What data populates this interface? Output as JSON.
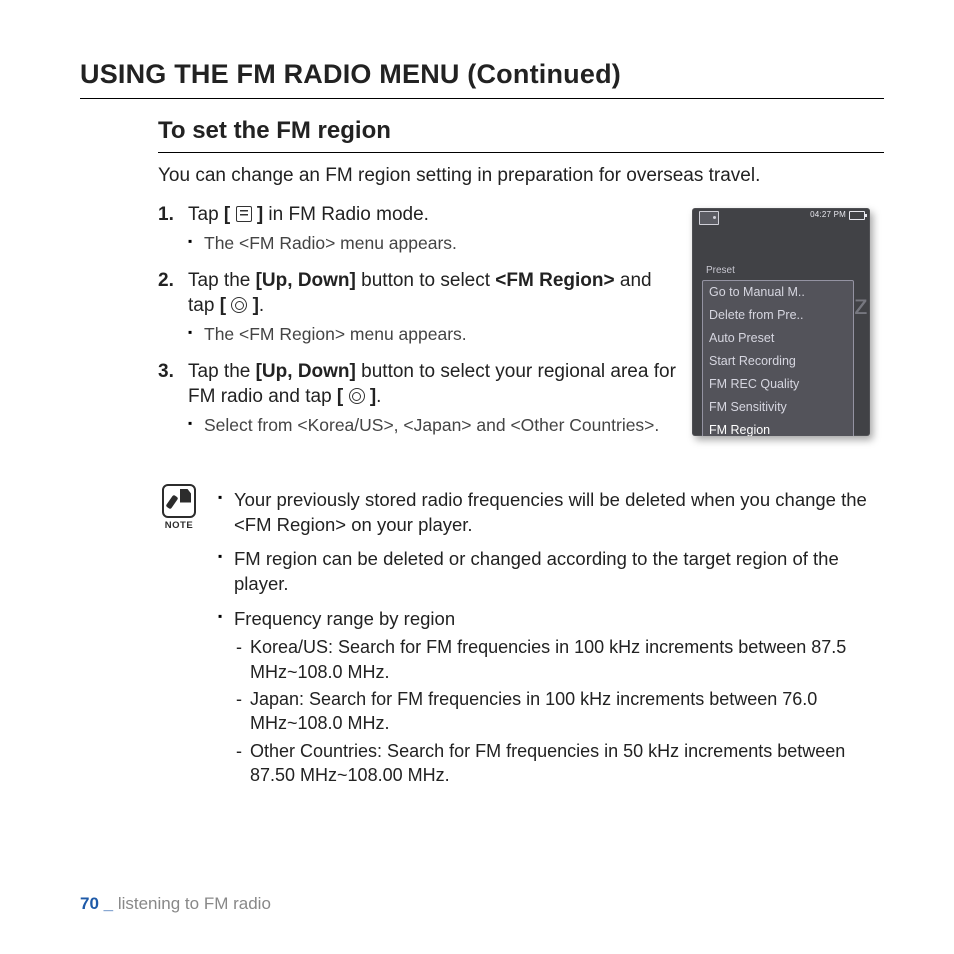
{
  "heading_main": "USING THE FM RADIO MENU (Continued)",
  "heading_sub": "To set the FM region",
  "intro": "You can change an FM region setting in preparation for overseas travel.",
  "steps": [
    {
      "num": "1.",
      "body_pre": "Tap ",
      "body_post": " in FM Radio mode.",
      "br1": "[",
      "br2": "]",
      "sub": "The <FM Radio> menu appears."
    },
    {
      "num": "2.",
      "line1": "Tap the ",
      "bold1": "[Up, Down]",
      "mid1": " button to select ",
      "bold2": "<FM Region>",
      "mid2": " and tap ",
      "br1": "[",
      "br2": "]",
      "end": ".",
      "sub": "The <FM Region> menu appears."
    },
    {
      "num": "3.",
      "line1": "Tap the ",
      "bold1": "[Up, Down]",
      "mid1": " button to select your regional area for FM radio and tap ",
      "br1": "[",
      "br2": "]",
      "end": ".",
      "sub": "Select from <Korea/US>, <Japan> and <Other Countries>."
    }
  ],
  "device": {
    "time": "04:27 PM",
    "preset_label": "Preset",
    "hz_hint": "Hz",
    "menu_items": [
      "Go to Manual M..",
      "Delete from Pre..",
      "Auto Preset",
      "Start Recording",
      "FM REC Quality",
      "FM Sensitivity",
      "FM Region"
    ],
    "selected_index": 6
  },
  "note_label": "NOTE",
  "notes": [
    "Your previously stored radio frequencies will be deleted when you change the <FM Region> on your player.",
    "FM region can be deleted or changed according to the target region of the player.",
    "Frequency range by region"
  ],
  "freq_ranges": [
    "Korea/US: Search for FM frequencies in 100 kHz increments between 87.5 MHz~108.0 MHz.",
    "Japan: Search for FM frequencies in 100 kHz increments between 76.0 MHz~108.0 MHz.",
    "Other Countries: Search for FM frequencies in 50 kHz increments between 87.50 MHz~108.00 MHz."
  ],
  "footer": {
    "page_num": "70",
    "sep": " _ ",
    "section": "listening to FM radio"
  }
}
